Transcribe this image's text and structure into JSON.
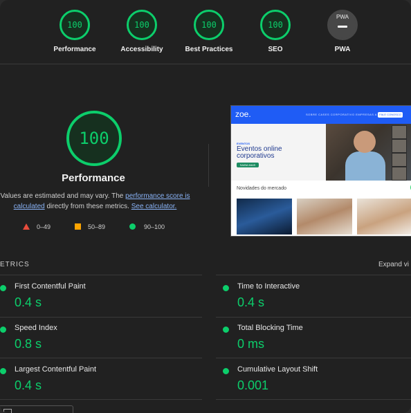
{
  "top_gauges": [
    {
      "label": "Performance",
      "score": "100"
    },
    {
      "label": "Accessibility",
      "score": "100"
    },
    {
      "label": "Best Practices",
      "score": "100"
    },
    {
      "label": "SEO",
      "score": "100"
    },
    {
      "label": "PWA",
      "score": "PWA"
    }
  ],
  "main": {
    "score": "100",
    "title": "Performance",
    "desc_prefix": "Values are estimated and may vary. The ",
    "link_score": "performance score is calculated",
    "desc_middle": " directly from these metrics. ",
    "link_calc": "See calculator."
  },
  "legend": {
    "fail": "0–49",
    "average": "50–89",
    "pass": "90–100"
  },
  "preview": {
    "logo": "zoe.",
    "nav_text": "SOBRE  CASES  CORPORATIVO  EMPRESAS  A ZOE",
    "nav_button": "FALE CONOSCO",
    "hero_small": "EVENTOS",
    "hero_heading": "Eventos online corporativos",
    "hero_cta": "SAIBA MAIS",
    "section_title": "Novidades do mercado"
  },
  "metrics": {
    "title": "ETRICS",
    "expand": "Expand vi",
    "items": [
      {
        "label": "First Contentful Paint",
        "value": "0.4 s"
      },
      {
        "label": "Time to Interactive",
        "value": "0.4 s"
      },
      {
        "label": "Speed Index",
        "value": "0.8 s"
      },
      {
        "label": "Total Blocking Time",
        "value": "0 ms"
      },
      {
        "label": "Largest Contentful Paint",
        "value": "0.4 s"
      },
      {
        "label": "Cumulative Layout Shift",
        "value": "0.001"
      }
    ]
  },
  "colors": {
    "pass": "#0cce6b",
    "average": "#ffa400",
    "fail": "#e74c3c",
    "link": "#8ab4f8"
  }
}
